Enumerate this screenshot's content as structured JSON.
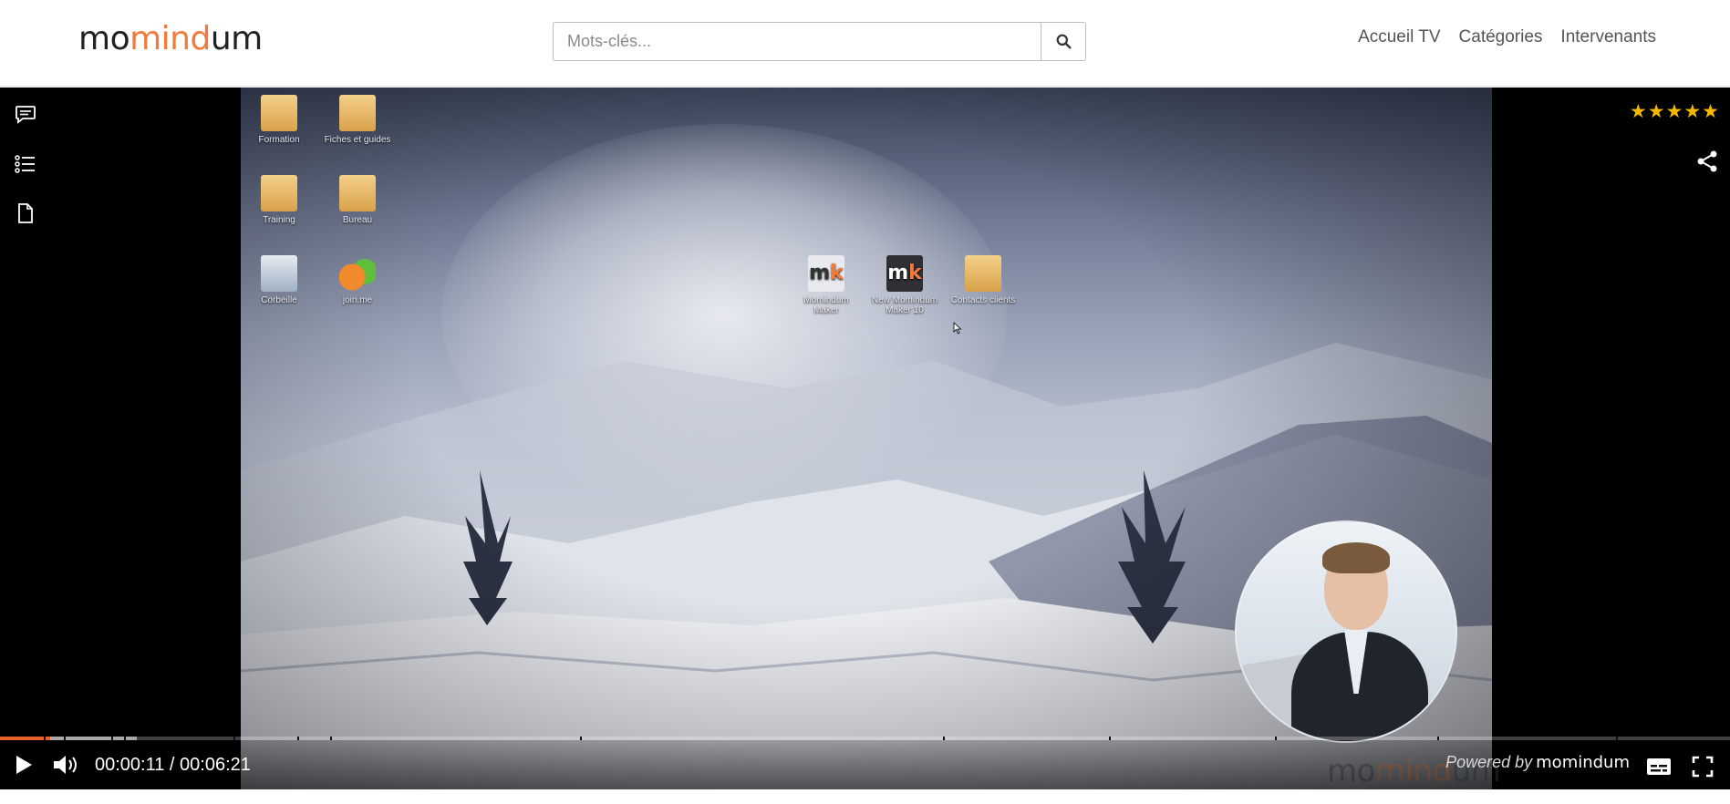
{
  "header": {
    "logo": {
      "part1": "mo",
      "accent": "mind",
      "part2": "um"
    },
    "search": {
      "placeholder": "Mots-clés...",
      "value": ""
    },
    "nav": [
      "Accueil TV",
      "Catégories",
      "Intervenants"
    ]
  },
  "player": {
    "desktop_icons": [
      {
        "label": "Formation",
        "icon": "folder-icon"
      },
      {
        "label": "Fiches et guides",
        "icon": "folder-icon"
      },
      {
        "label": "Training",
        "icon": "folder-icon"
      },
      {
        "label": "Bureau",
        "icon": "folder-icon"
      },
      {
        "label": "Corbeille",
        "icon": "recycle-bin-icon"
      },
      {
        "label": "join.me",
        "icon": "joinme-icon"
      },
      {
        "label": "Momindum Maker",
        "icon": "mk-icon"
      },
      {
        "label": "New Momindum Maker 10",
        "icon": "mk-icon"
      },
      {
        "label": "Contacts clients",
        "icon": "folder-icon"
      }
    ],
    "rating": {
      "value": 5,
      "max": 5
    },
    "time": {
      "current": "00:00:11",
      "total": "00:06:21"
    },
    "progress": {
      "played_fraction": 0.029
    },
    "powered_by": {
      "label": "Powered by",
      "brand": "momindum"
    },
    "watermark": {
      "part1": "mo",
      "accent": "mind",
      "part2": "um"
    }
  },
  "colors": {
    "accent": "#f07b3c",
    "star": "#f5b800",
    "progress": "#e9622c"
  }
}
